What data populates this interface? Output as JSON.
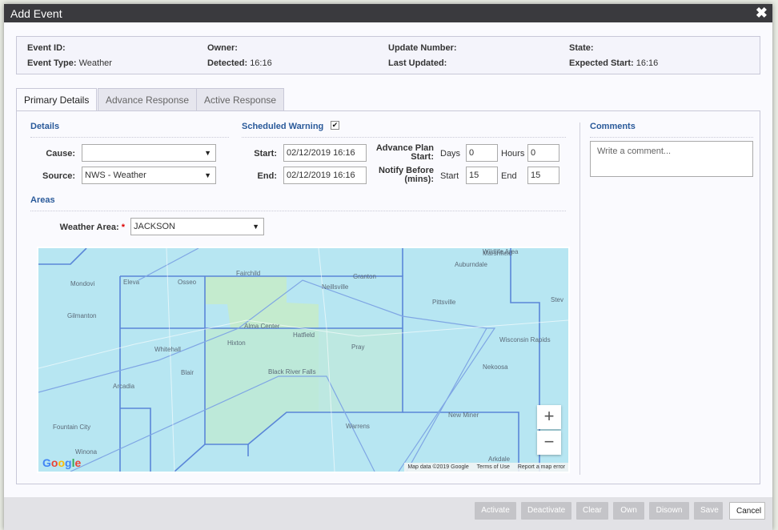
{
  "dialog": {
    "title": "Add Event"
  },
  "info": {
    "event_id_label": "Event ID:",
    "event_type_label": "Event Type:",
    "event_type_value": "Weather",
    "owner_label": "Owner:",
    "detected_label": "Detected:",
    "detected_value": "16:16",
    "update_number_label": "Update Number:",
    "last_updated_label": "Last Updated:",
    "state_label": "State:",
    "expected_start_label": "Expected Start:",
    "expected_start_value": "16:16"
  },
  "tabs": [
    {
      "label": "Primary Details",
      "active": true
    },
    {
      "label": "Advance Response",
      "active": false
    },
    {
      "label": "Active Response",
      "active": false
    }
  ],
  "details": {
    "heading": "Details",
    "cause_label": "Cause:",
    "cause_value": "",
    "source_label": "Source:",
    "source_value": "NWS - Weather"
  },
  "warning": {
    "heading": "Scheduled Warning",
    "checked": true,
    "start_label": "Start:",
    "start_value": "02/12/2019 16:16",
    "end_label": "End:",
    "end_value": "02/12/2019 16:16",
    "advance_label_1": "Advance Plan",
    "advance_label_2": "Start:",
    "days_label": "Days",
    "days_value": "0",
    "hours_label": "Hours",
    "hours_value": "0",
    "notify_label_1": "Notify Before",
    "notify_label_2": "(mins):",
    "notify_start_label": "Start",
    "notify_start_value": "15",
    "notify_end_label": "End",
    "notify_end_value": "15"
  },
  "comments": {
    "heading": "Comments",
    "placeholder": "Write a comment..."
  },
  "areas": {
    "heading": "Areas",
    "weather_area_label": "Weather Area:",
    "required_mark": "*",
    "weather_area_value": "JACKSON"
  },
  "map": {
    "places": [
      "Marshfield",
      "Auburndale",
      "Wildlife Area",
      "Mondovi",
      "Eleva",
      "Osseo",
      "Fairchild",
      "Granton",
      "Neillsville",
      "Gilmanton",
      "Alma Center",
      "Hatfield",
      "Pittsville",
      "Hixton",
      "Whitehall",
      "Pray",
      "Wisconsin Rapids",
      "Blair",
      "Black River Falls",
      "Nekoosa",
      "Arcadia",
      "Fountain City",
      "New Miner",
      "Warrens",
      "Winona",
      "Arkdale",
      "Stev"
    ],
    "zoom_in": "+",
    "zoom_out": "−",
    "logo": "Google",
    "attribution": "Map data ©2019 Google",
    "terms": "Terms of Use",
    "report": "Report a map error"
  },
  "footer": {
    "activate": "Activate",
    "deactivate": "Deactivate",
    "clear": "Clear",
    "own": "Own",
    "disown": "Disown",
    "save": "Save",
    "cancel": "Cancel"
  }
}
